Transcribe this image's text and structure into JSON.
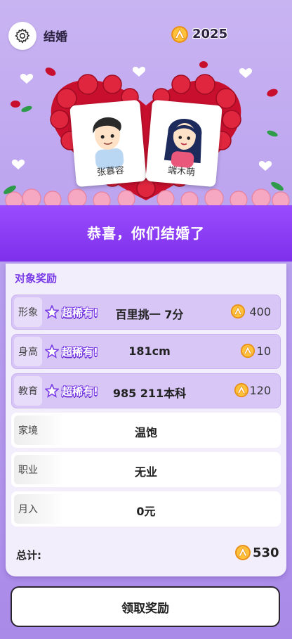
{
  "header": {
    "title": "结婚",
    "coins": "2025"
  },
  "hero": {
    "left_name": "张慕容",
    "right_name": "端木萌"
  },
  "banner": {
    "title": "恭喜，你们结婚了"
  },
  "rewards": {
    "title": "对象奖励",
    "rare_label": "超稀有!",
    "rows": [
      {
        "label": "形象",
        "value": "百里挑一 7分",
        "reward": "400",
        "rare": true
      },
      {
        "label": "身高",
        "value": "181cm",
        "reward": "10",
        "rare": true
      },
      {
        "label": "教育",
        "value": "985 211本科",
        "reward": "120",
        "rare": true
      },
      {
        "label": "家境",
        "value": "温饱",
        "rare": false
      },
      {
        "label": "职业",
        "value": "无业",
        "rare": false
      },
      {
        "label": "月入",
        "value": "0元",
        "rare": false
      }
    ],
    "total_label": "总计:",
    "total_value": "530"
  },
  "claim_button": {
    "label": "领取奖励"
  },
  "colors": {
    "accent": "#7d2fea",
    "coin": "#f4a91c"
  }
}
